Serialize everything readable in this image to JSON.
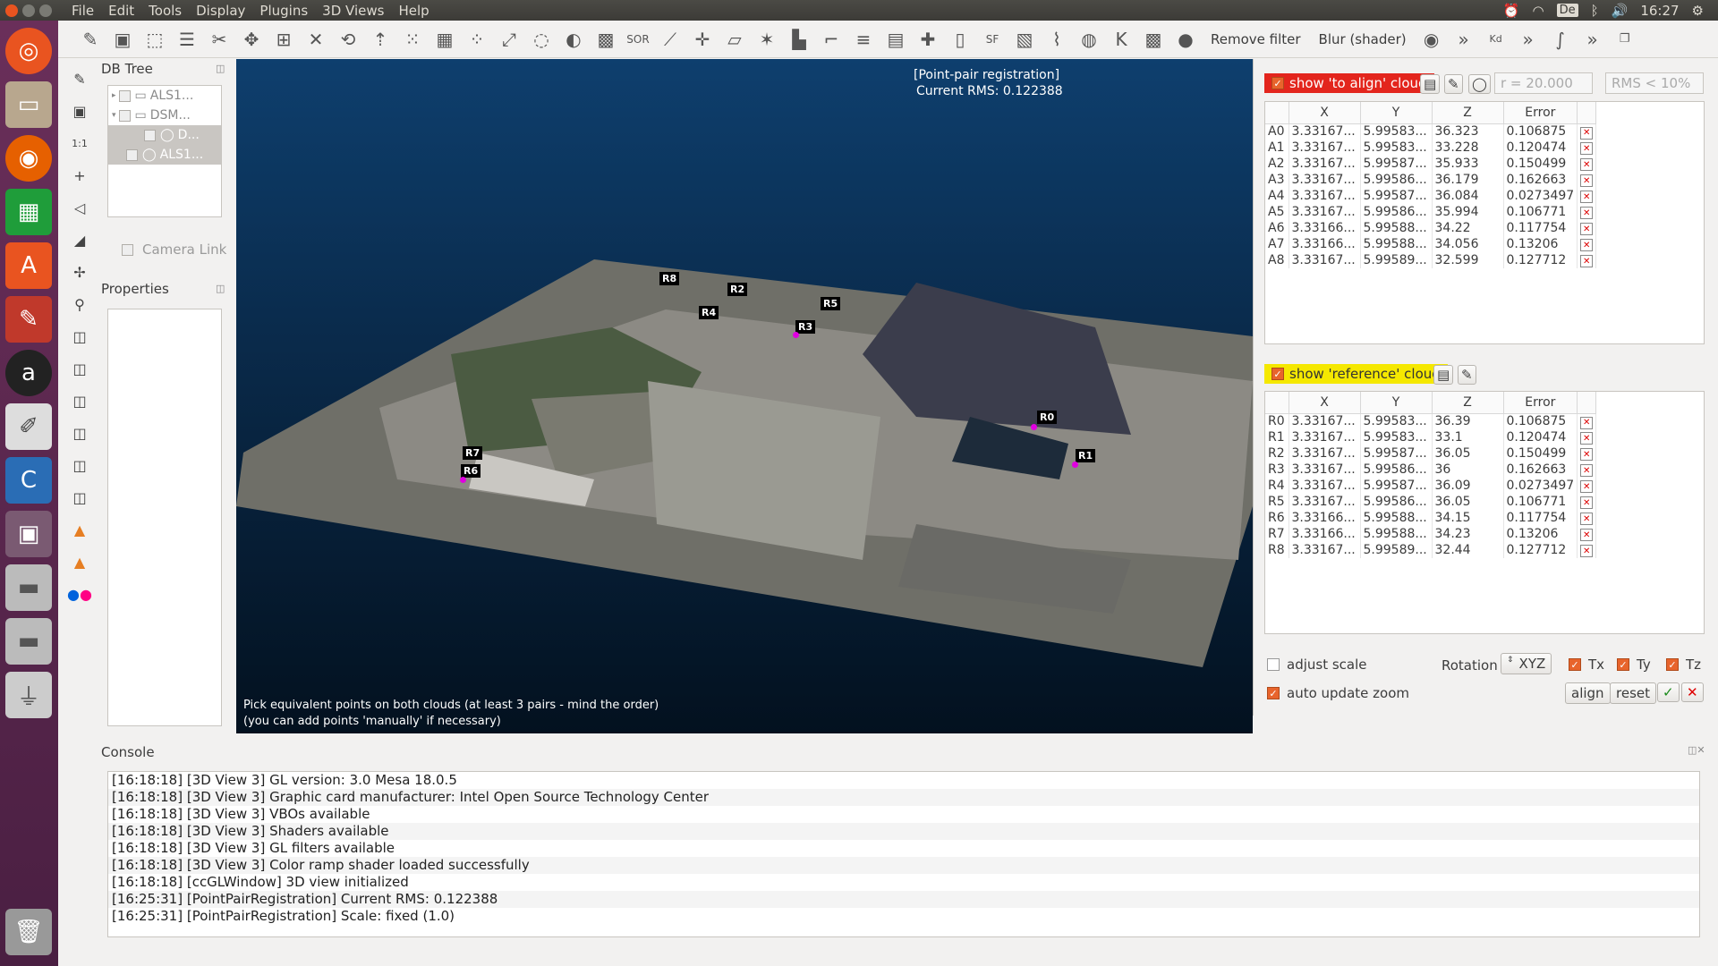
{
  "menu": [
    "File",
    "Edit",
    "Tools",
    "Display",
    "Plugins",
    "3D Views",
    "Help"
  ],
  "tray": {
    "kb": "De",
    "clock": "16:27"
  },
  "toolbar": {
    "remove_filter": "Remove filter",
    "blur": "Blur (shader)"
  },
  "dbtree": {
    "title": "DB Tree",
    "rows": [
      "ALS1...",
      "DSM...",
      "D...",
      "ALS1..."
    ],
    "camera_link": "Camera Link"
  },
  "properties": {
    "title": "Properties"
  },
  "view": {
    "title": "[Point-pair registration]",
    "rms": "Current RMS: 0.122388",
    "hint1": "Pick equivalent points on both clouds (at least 3 pairs - mind the order)",
    "hint2": "(you can add points 'manually' if necessary)",
    "labels": [
      "R8",
      "R2",
      "R5",
      "R4",
      "R3",
      "R0",
      "R1",
      "R7",
      "R6"
    ]
  },
  "align_panel": {
    "show_align": "show 'to align' cloud",
    "radius": "r = 20.000",
    "rms_filter": "RMS < 10%",
    "show_ref": "show 'reference' cloud",
    "columns": [
      "X",
      "Y",
      "Z",
      "Error"
    ],
    "align_rows": [
      [
        "A0",
        "3.33167...",
        "5.99583...",
        "36.323",
        "0.106875"
      ],
      [
        "A1",
        "3.33167...",
        "5.99583...",
        "33.228",
        "0.120474"
      ],
      [
        "A2",
        "3.33167...",
        "5.99587...",
        "35.933",
        "0.150499"
      ],
      [
        "A3",
        "3.33167...",
        "5.99586...",
        "36.179",
        "0.162663"
      ],
      [
        "A4",
        "3.33167...",
        "5.99587...",
        "36.084",
        "0.0273497"
      ],
      [
        "A5",
        "3.33167...",
        "5.99586...",
        "35.994",
        "0.106771"
      ],
      [
        "A6",
        "3.33166...",
        "5.99588...",
        "34.22",
        "0.117754"
      ],
      [
        "A7",
        "3.33166...",
        "5.99588...",
        "34.056",
        "0.13206"
      ],
      [
        "A8",
        "3.33167...",
        "5.99589...",
        "32.599",
        "0.127712"
      ]
    ],
    "ref_rows": [
      [
        "R0",
        "3.33167...",
        "5.99583...",
        "36.39",
        "0.106875"
      ],
      [
        "R1",
        "3.33167...",
        "5.99583...",
        "33.1",
        "0.120474"
      ],
      [
        "R2",
        "3.33167...",
        "5.99587...",
        "36.05",
        "0.150499"
      ],
      [
        "R3",
        "3.33167...",
        "5.99586...",
        "36",
        "0.162663"
      ],
      [
        "R4",
        "3.33167...",
        "5.99587...",
        "36.09",
        "0.0273497"
      ],
      [
        "R5",
        "3.33167...",
        "5.99586...",
        "36.05",
        "0.106771"
      ],
      [
        "R6",
        "3.33166...",
        "5.99588...",
        "34.15",
        "0.117754"
      ],
      [
        "R7",
        "3.33166...",
        "5.99588...",
        "34.23",
        "0.13206"
      ],
      [
        "R8",
        "3.33167...",
        "5.99589...",
        "32.44",
        "0.127712"
      ]
    ],
    "adjust_scale": "adjust scale",
    "rotation": "Rotation",
    "rotation_val": "XYZ",
    "tx": "Tx",
    "ty": "Ty",
    "tz": "Tz",
    "auto_zoom": "auto update zoom",
    "align_btn": "align",
    "reset_btn": "reset"
  },
  "console": {
    "title": "Console",
    "lines": [
      "[16:18:18] [3D View 3] GL version: 3.0 Mesa 18.0.5",
      "[16:18:18] [3D View 3] Graphic card manufacturer: Intel Open Source Technology Center",
      "[16:18:18] [3D View 3] VBOs available",
      "[16:18:18] [3D View 3] Shaders available",
      "[16:18:18] [3D View 3] GL filters available",
      "[16:18:18] [3D View 3] Color ramp shader loaded successfully",
      "[16:18:18] [ccGLWindow] 3D view initialized",
      "[16:25:31] [PointPairRegistration] Current RMS: 0.122388",
      "[16:25:31] [PointPairRegistration] Scale: fixed (1.0)"
    ]
  }
}
